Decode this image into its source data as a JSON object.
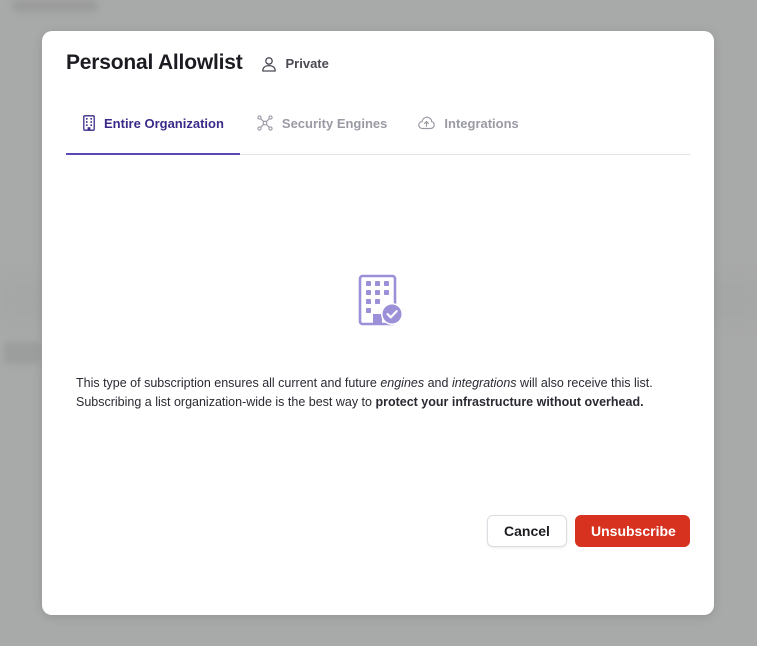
{
  "modal": {
    "title": "Personal Allowlist",
    "visibility": "Private"
  },
  "tabs": [
    {
      "label": "Entire Organization",
      "icon": "building-icon",
      "active": true
    },
    {
      "label": "Security Engines",
      "icon": "network-nodes-icon",
      "active": false
    },
    {
      "label": "Integrations",
      "icon": "cloud-upload-icon",
      "active": false
    }
  ],
  "content": {
    "icon": "building-check-icon",
    "line1_a": "This type of subscription ensures all current and future ",
    "line1_engines": "engines",
    "line1_and": " and ",
    "line1_integrations": "integrations",
    "line1_b": " will also receive this list.",
    "line2_a": "Subscribing a list organization-wide is the best way to ",
    "line2_bold": "protect your infrastructure without overhead."
  },
  "actions": {
    "cancel_label": "Cancel",
    "unsubscribe_label": "Unsubscribe"
  },
  "colors": {
    "accent": "#5a48b5",
    "active_tab_text": "#3b2a8a",
    "danger": "#d6321f",
    "icon_tint": "#9c90d9"
  }
}
